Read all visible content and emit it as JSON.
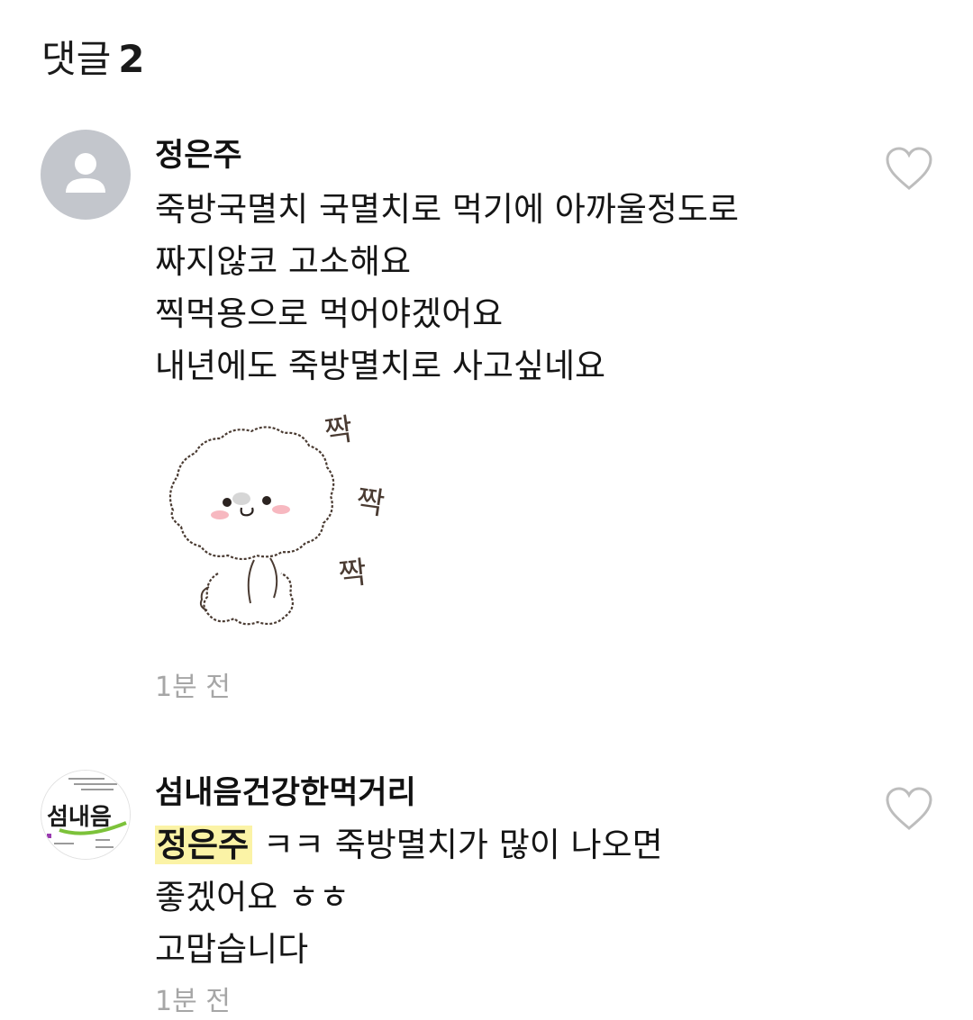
{
  "header": {
    "label": "댓글",
    "count": "2"
  },
  "comments": [
    {
      "author": "정은주",
      "avatar_icon": "default-user-icon",
      "lines": [
        "죽방국멸치 국멸치로 먹기에 아까울정도로",
        "짜지않코 고소해요",
        "찍먹용으로 먹어야겠어요",
        "내년에도 죽방멸치로 사고싶네요"
      ],
      "sticker": {
        "icon": "dog-sticker-icon",
        "text": [
          "짝",
          "짝",
          "짝"
        ]
      },
      "time": "1분 전",
      "like_icon": "heart-outline-icon"
    },
    {
      "author": "섬내음건강한먹거리",
      "avatar_icon": "shop-logo-icon",
      "avatar_logo_text": "섬내음",
      "mention": "정은주",
      "first_line_rest": "ㅋㅋ 죽방멸치가 많이 나오면",
      "lines": [
        "좋겠어요 ㅎㅎ",
        "고맙습니다"
      ],
      "time": "1분 전",
      "like_icon": "heart-outline-icon"
    }
  ],
  "colors": {
    "mention_highlight": "#fbf3a6",
    "time_gray": "#a6a6a6",
    "avatar_gray": "#c3c6cc"
  }
}
